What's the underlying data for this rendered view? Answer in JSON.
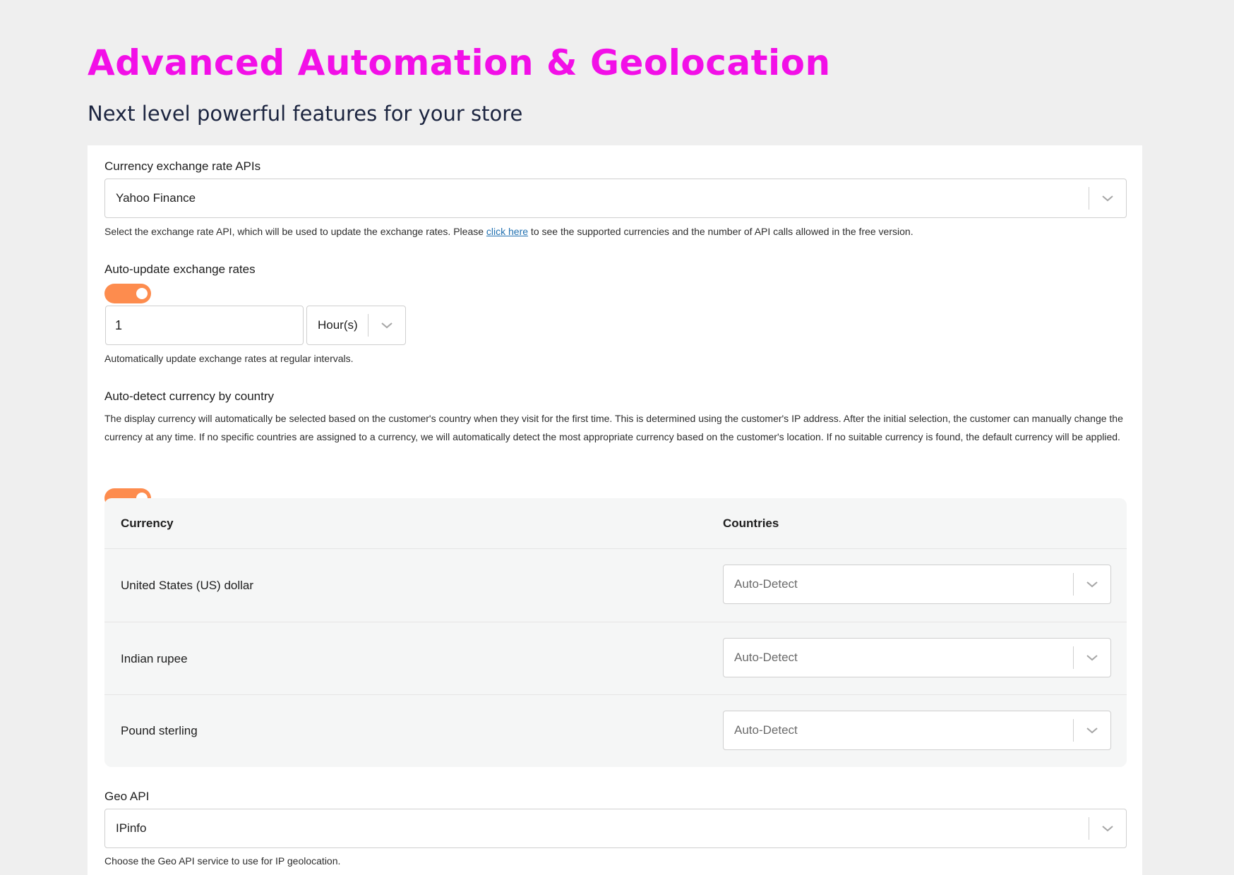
{
  "hero": {
    "title": "Advanced Automation & Geolocation",
    "subtitle": "Next level powerful features for your store"
  },
  "exchange_api": {
    "label": "Currency exchange rate APIs",
    "selected": "Yahoo Finance",
    "help_before": "Select the exchange rate API, which will be used to update the exchange rates. Please ",
    "help_link": "click here",
    "help_after": " to see the supported currencies and the number of API calls allowed in the free version."
  },
  "auto_update": {
    "label": "Auto-update exchange rates",
    "enabled": true,
    "interval_value": "1",
    "interval_unit": "Hour(s)",
    "help": "Automatically update exchange rates at regular intervals."
  },
  "auto_detect": {
    "label": "Auto-detect currency by country",
    "description": "The display currency will automatically be selected based on the customer's country when they visit for the first time. This is determined using the customer's IP address. After the initial selection, the customer can manually change the currency at any time. If no specific countries are assigned to a currency, we will automatically detect the most appropriate currency based on the customer's location. If no suitable currency is found, the default currency will be applied.",
    "enabled": true
  },
  "currency_table": {
    "headers": [
      "Currency",
      "Countries"
    ],
    "rows": [
      {
        "currency": "United States (US) dollar",
        "countries": "Auto-Detect"
      },
      {
        "currency": "Indian rupee",
        "countries": "Auto-Detect"
      },
      {
        "currency": "Pound sterling",
        "countries": "Auto-Detect"
      }
    ]
  },
  "geo_api": {
    "label": "Geo API",
    "selected": "IPinfo",
    "help": "Choose the Geo API service to use for IP geolocation."
  },
  "colors": {
    "title_magenta": "#f20fe7",
    "toggle_orange": "#fd8c4e",
    "link_blue": "#2271b1",
    "page_bg": "#efefef"
  },
  "icons": {
    "dropdown": "chevron-down-icon"
  }
}
